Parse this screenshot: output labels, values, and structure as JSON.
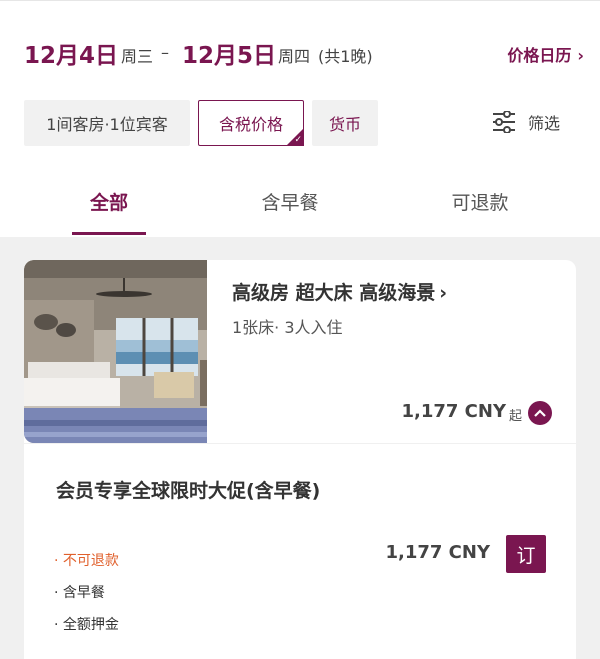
{
  "header": {
    "checkin_date": "12月4日",
    "checkin_weekday": "周三",
    "date_separator": "–",
    "checkout_date": "12月5日",
    "checkout_weekday": "周四",
    "nights": "(共1晚)",
    "calendar_link": "价格日历"
  },
  "filters": {
    "guests_chip": "1间客房·1位宾客",
    "tax_chip": "含税价格",
    "currency_chip": "货币",
    "filter_button": "筛选"
  },
  "tabs": [
    {
      "label": "全部",
      "active": true
    },
    {
      "label": "含早餐",
      "active": false
    },
    {
      "label": "可退款",
      "active": false
    }
  ],
  "room": {
    "title": "高级房 超大床 高级海景",
    "subtitle": "1张床· 3人入住",
    "price": "1,177 CNY",
    "price_from": "起"
  },
  "rate": {
    "name": "会员专享全球限时大促(含早餐)",
    "perks": [
      "· 不可退款",
      "· 含早餐",
      "· 全额押金"
    ],
    "price": "1,177 CNY",
    "book_label": "订"
  },
  "colors": {
    "brand": "#7a1650",
    "warning": "#e0602c"
  }
}
